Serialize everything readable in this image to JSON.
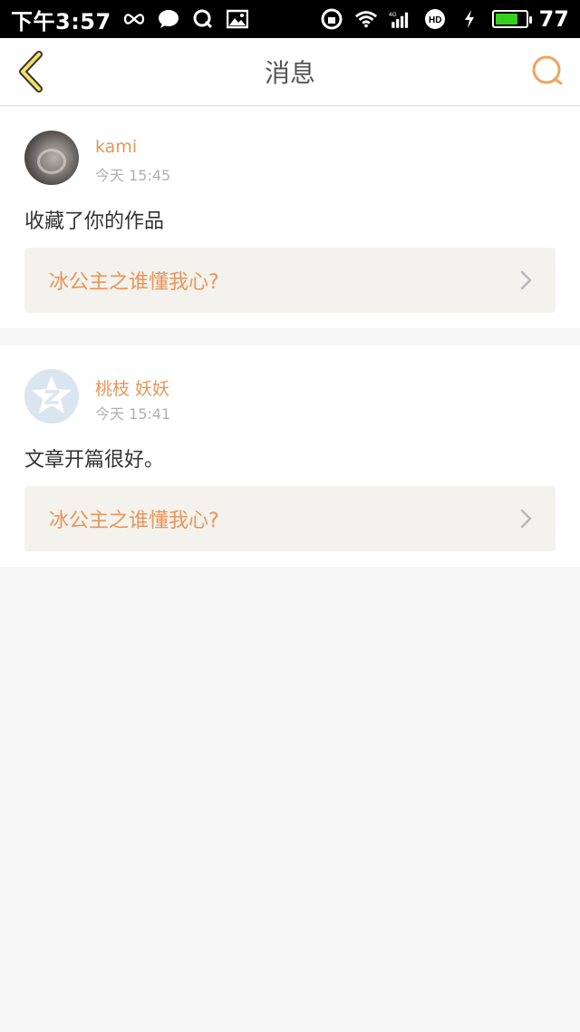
{
  "status_bar": {
    "time": "下午3:57",
    "battery_level": "77",
    "battery_fraction": 0.77,
    "network": "4G",
    "icons": [
      "infinity-icon",
      "chat-bubble-icon",
      "q-icon",
      "image-icon",
      "rotation-lock-icon",
      "wifi-icon",
      "signal-icon",
      "hd-icon",
      "charging-icon",
      "battery-icon"
    ]
  },
  "header": {
    "title": "消息",
    "back_icon": "chevron-left-icon",
    "search_icon": "search-icon",
    "accent_color": "#f2a35c",
    "back_color": "#f5e063"
  },
  "messages": [
    {
      "username": "kami",
      "time": "今天 15:45",
      "content": "收藏了你的作品",
      "work_title": "冰公主之谁懂我心?",
      "avatar": "photo-avatar"
    },
    {
      "username": "桃枝 妖妖",
      "time": "今天 15:41",
      "content": "文章开篇很好。",
      "work_title": "冰公主之谁懂我心?",
      "avatar": "default-qzone-avatar"
    }
  ],
  "colors": {
    "username": "#e8955a",
    "work_title": "#e8955a",
    "work_bg": "#f3f2ec",
    "page_bg": "#f5f5f5"
  }
}
